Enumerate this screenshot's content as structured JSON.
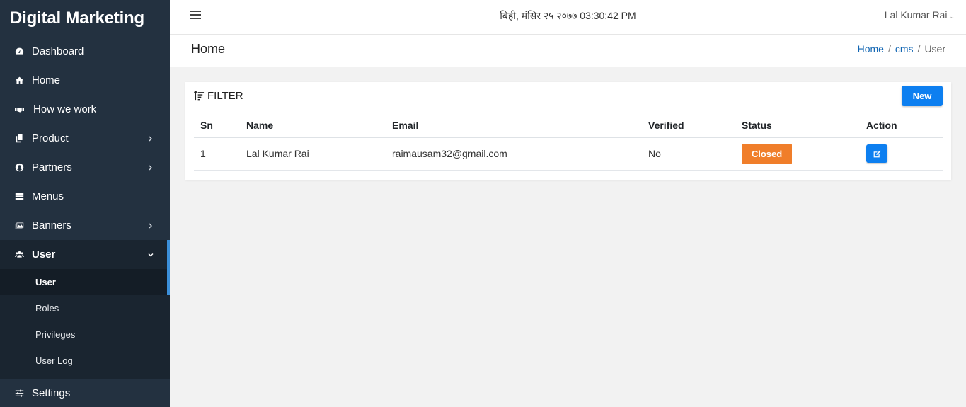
{
  "app": {
    "brand": "Digital Marketing"
  },
  "sidebar": {
    "items": [
      {
        "label": "Dashboard",
        "icon": "dashboard-icon",
        "has_children": false
      },
      {
        "label": "Home",
        "icon": "home-icon",
        "has_children": false
      },
      {
        "label": "How we work",
        "icon": "handshake-icon",
        "has_children": false
      },
      {
        "label": "Product",
        "icon": "copy-icon",
        "has_children": true
      },
      {
        "label": "Partners",
        "icon": "user-circle-icon",
        "has_children": true
      },
      {
        "label": "Menus",
        "icon": "grid-icon",
        "has_children": false
      },
      {
        "label": "Banners",
        "icon": "images-icon",
        "has_children": true
      },
      {
        "label": "User",
        "icon": "users-icon",
        "has_children": true,
        "expanded": true
      },
      {
        "label": "Settings",
        "icon": "sliders-icon",
        "has_children": false
      }
    ],
    "user_submenu": [
      "User",
      "Roles",
      "Privileges",
      "User Log"
    ],
    "active_sub": "User",
    "accent": "#3b8fd9"
  },
  "topbar": {
    "datetime": "बिही, मंसिर २५ २०७७ 03:30:42 PM",
    "user_name": "Lal Kumar Rai",
    "caret": "⌄"
  },
  "page": {
    "title": "Home",
    "breadcrumb": [
      "Home",
      "cms",
      "User"
    ],
    "breadcrumb_sep": "/"
  },
  "card": {
    "filter_label": "FILTER",
    "new_button": "New",
    "columns": [
      "Sn",
      "Name",
      "Email",
      "Verified",
      "Status",
      "Action"
    ],
    "rows": [
      {
        "sn": "1",
        "name": "Lal Kumar Rai",
        "email": "raimausam32@gmail.com",
        "verified": "No",
        "status": "Closed"
      }
    ]
  },
  "colors": {
    "primary": "#0d7ff0",
    "status_closed": "#f07e2a",
    "sidebar_bg": "#233140"
  }
}
